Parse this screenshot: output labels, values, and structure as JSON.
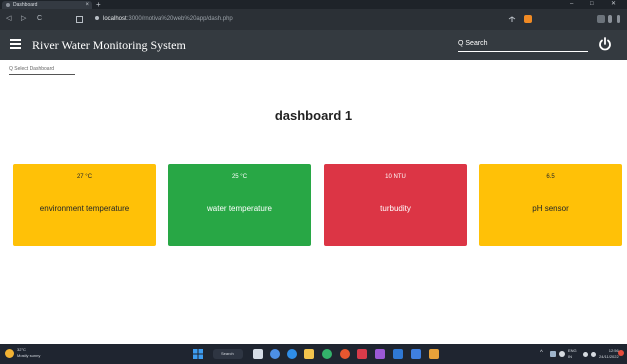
{
  "browser": {
    "tab_title": "Dashboard",
    "tab_close": "×",
    "new_tab": "+",
    "url_host": "localhost",
    "url_path": ":3000/rnotiva%20web%20app/dash.php",
    "win_minimize": "–",
    "win_maximize": "□",
    "win_close": "✕",
    "back": "◁",
    "forward": "▷",
    "reload": "C"
  },
  "header": {
    "title": "River Water Monitoring System",
    "search_label": "Q Search"
  },
  "dashboard_select": "Q Select Dashboard",
  "dashboard": {
    "title": "dashboard 1",
    "cards": [
      {
        "value": "27 °C",
        "label": "environment temperature",
        "bg": "#ffc107",
        "fg": "#212529"
      },
      {
        "value": "25 °C",
        "label": "water temperature",
        "bg": "#28a745",
        "fg": "#ffffff"
      },
      {
        "value": "10 NTU",
        "label": "turbudity",
        "bg": "#dc3545",
        "fg": "#ffffff"
      },
      {
        "value": "6.5",
        "label": "pH sensor",
        "bg": "#ffc107",
        "fg": "#212529"
      }
    ]
  },
  "taskbar": {
    "weather_temp": "32°C",
    "weather_desc": "Mostly sunny",
    "search_label": "Search",
    "lang_line1": "ENG",
    "lang_line2": "IN",
    "time": "12:56",
    "date": "24/11/2022"
  }
}
